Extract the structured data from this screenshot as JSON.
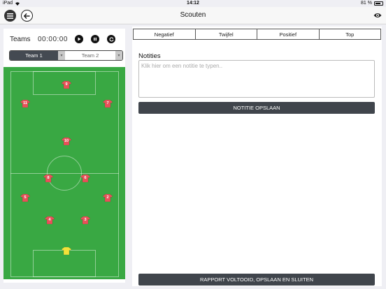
{
  "status": {
    "device": "iPad",
    "time": "14:12",
    "battery": "81 %",
    "battery_level": 0.81
  },
  "nav": {
    "title": "Scouten"
  },
  "left": {
    "teams_label": "Teams",
    "timer": "00:00:00",
    "team1": "Team 1",
    "team2": "Team 2",
    "players": [
      {
        "number": "9",
        "kind": "field"
      },
      {
        "number": "11",
        "kind": "field"
      },
      {
        "number": "7",
        "kind": "field"
      },
      {
        "number": "10",
        "kind": "field"
      },
      {
        "number": "8",
        "kind": "field"
      },
      {
        "number": "6",
        "kind": "field"
      },
      {
        "number": "5",
        "kind": "field"
      },
      {
        "number": "2",
        "kind": "field"
      },
      {
        "number": "4",
        "kind": "field"
      },
      {
        "number": "3",
        "kind": "field"
      },
      {
        "number": "",
        "kind": "keeper"
      }
    ]
  },
  "right": {
    "filters": [
      "Negatief",
      "Twijfel",
      "Positief",
      "Top"
    ],
    "notes_label": "Notities",
    "notes_placeholder": "Klik hier om een notitie te typen..",
    "notes_value": "",
    "save_button": "NOTITIE OPSLAAN",
    "finish_button": "RAPPORT VOLTOOID, OPSLAAN EN SLUITEN"
  },
  "colors": {
    "field": "#39a843",
    "shirt": "#e8525a",
    "keeper": "#f2e23a",
    "button": "#40454c"
  },
  "icons": {
    "menu": "hamburger-menu-icon",
    "back": "back-arrow-icon",
    "eye": "eye-icon",
    "play": "play-icon",
    "pause": "pause-icon",
    "reset": "reset-icon"
  }
}
